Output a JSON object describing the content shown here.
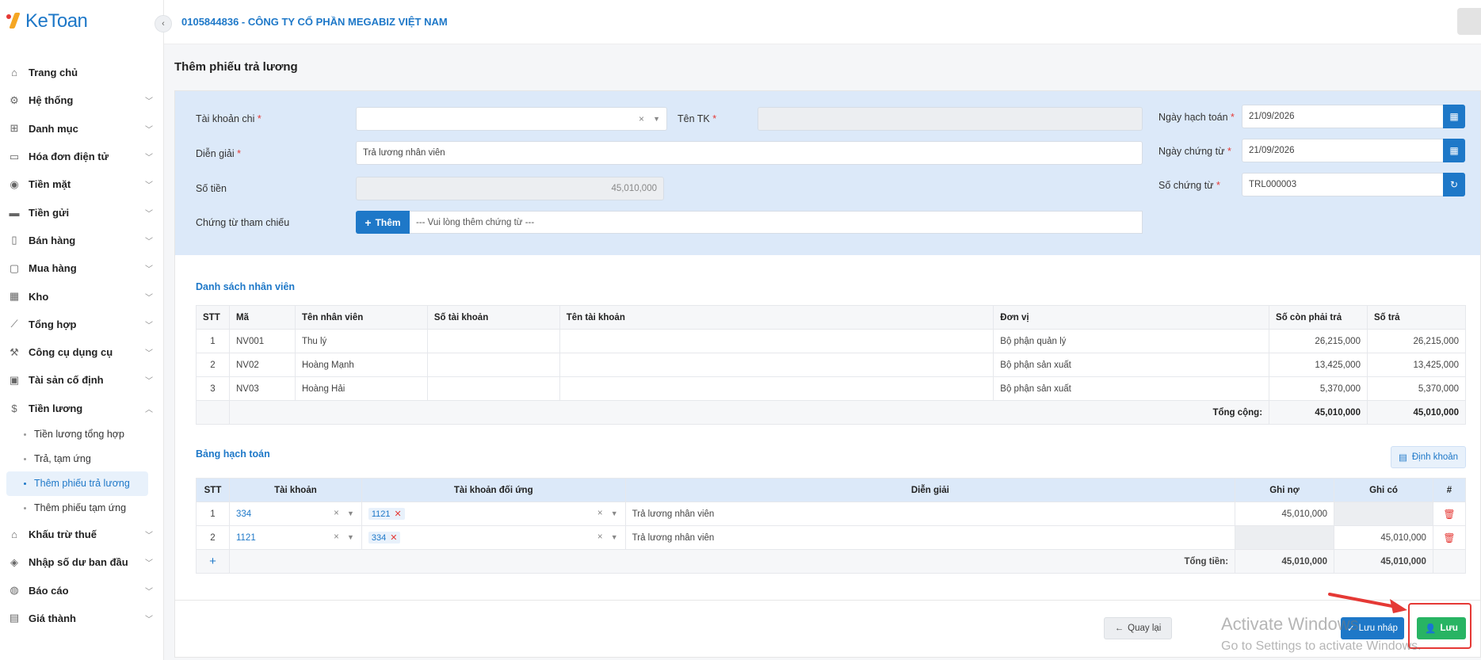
{
  "brand": {
    "name": "KeToan"
  },
  "header": {
    "company": "0105844836 - CÔNG TY CỔ PHẦN MEGABIZ VIỆT NAM"
  },
  "sidebar": {
    "items": [
      {
        "label": "Trang chủ",
        "icon": "home-icon"
      },
      {
        "label": "Hệ thống",
        "icon": "gear-icon"
      },
      {
        "label": "Danh mục",
        "icon": "grid-icon"
      },
      {
        "label": "Hóa đơn điện tử",
        "icon": "invoice-icon"
      },
      {
        "label": "Tiền mặt",
        "icon": "cash-icon"
      },
      {
        "label": "Tiền gửi",
        "icon": "bank-card-icon"
      },
      {
        "label": "Bán hàng",
        "icon": "sell-icon"
      },
      {
        "label": "Mua hàng",
        "icon": "buy-icon"
      },
      {
        "label": "Kho",
        "icon": "warehouse-icon"
      },
      {
        "label": "Tổng hợp",
        "icon": "chart-icon"
      },
      {
        "label": "Công cụ dụng cụ",
        "icon": "tools-icon"
      },
      {
        "label": "Tài sản cố định",
        "icon": "car-icon"
      },
      {
        "label": "Tiền lương",
        "icon": "dollar-icon"
      }
    ],
    "sub_items": [
      {
        "label": "Tiền lương tổng hợp"
      },
      {
        "label": "Trả, tạm ứng"
      },
      {
        "label": "Thêm phiếu trả lương"
      },
      {
        "label": "Thêm phiếu tạm ứng"
      }
    ],
    "items_after": [
      {
        "label": "Khấu trừ thuế",
        "icon": "tax-icon"
      },
      {
        "label": "Nhập số dư ban đầu",
        "icon": "balance-icon"
      },
      {
        "label": "Báo cáo",
        "icon": "report-icon"
      },
      {
        "label": "Giá thành",
        "icon": "cost-icon"
      }
    ]
  },
  "page": {
    "title": "Thêm phiếu trả lương"
  },
  "form": {
    "tai_khoan_chi_label": "Tài khoản chi",
    "ten_tk_label": "Tên TK",
    "dien_giai_label": "Diễn giải",
    "dien_giai_value": "Trả lương nhân viên",
    "so_tien_label": "Số tiền",
    "so_tien_value": "45,010,000",
    "chung_tu_label": "Chứng từ tham chiếu",
    "them_button": "Thêm",
    "chung_tu_placeholder": "--- Vui lòng thêm chứng từ ---",
    "ngay_hach_toan_label": "Ngày hạch toán",
    "ngay_hach_toan_value": "21/09/2026",
    "ngay_chung_tu_label": "Ngày chứng từ",
    "ngay_chung_tu_value": "21/09/2026",
    "so_chung_tu_label": "Số chứng từ",
    "so_chung_tu_value": "TRL000003",
    "required_mark": "*"
  },
  "employees": {
    "title": "Danh sách nhân viên",
    "headers": [
      "STT",
      "Mã",
      "Tên nhân viên",
      "Số tài khoản",
      "Tên tài khoản",
      "Đơn vị",
      "Số còn phải trả",
      "Số trả"
    ],
    "rows": [
      [
        "1",
        "NV001",
        "Thu lý",
        "",
        "",
        "Bộ phận quản lý",
        "26,215,000",
        "26,215,000"
      ],
      [
        "2",
        "NV02",
        "Hoàng Mạnh",
        "",
        "",
        "Bộ phận sản xuất",
        "13,425,000",
        "13,425,000"
      ],
      [
        "3",
        "NV03",
        "Hoàng Hải",
        "",
        "",
        "Bộ phận sản xuất",
        "5,370,000",
        "5,370,000"
      ]
    ],
    "total_label": "Tổng cộng:",
    "total_remaining": "45,010,000",
    "total_paid": "45,010,000"
  },
  "accounting": {
    "title": "Bảng hạch toán",
    "dinh_khoan_button": "Định khoản",
    "headers": [
      "STT",
      "Tài khoản",
      "Tài khoản đối ứng",
      "Diễn giải",
      "Ghi nợ",
      "Ghi có",
      "#"
    ],
    "rows": [
      {
        "stt": "1",
        "account": "334",
        "counter": "1121",
        "desc": "Trả lương nhân viên",
        "debit": "45,010,000",
        "credit": ""
      },
      {
        "stt": "2",
        "account": "1121",
        "counter": "334",
        "desc": "Trả lương nhân viên",
        "debit": "",
        "credit": "45,010,000"
      }
    ],
    "add_symbol": "+",
    "total_label": "Tổng tiền:",
    "total_debit": "45,010,000",
    "total_credit": "45,010,000"
  },
  "footer": {
    "back_button": "Quay lại",
    "draft_button": "Lưu nháp",
    "save_button": "Lưu"
  },
  "watermark": {
    "line1": "Activate Windows",
    "line2": "Go to Settings to activate Windows."
  }
}
